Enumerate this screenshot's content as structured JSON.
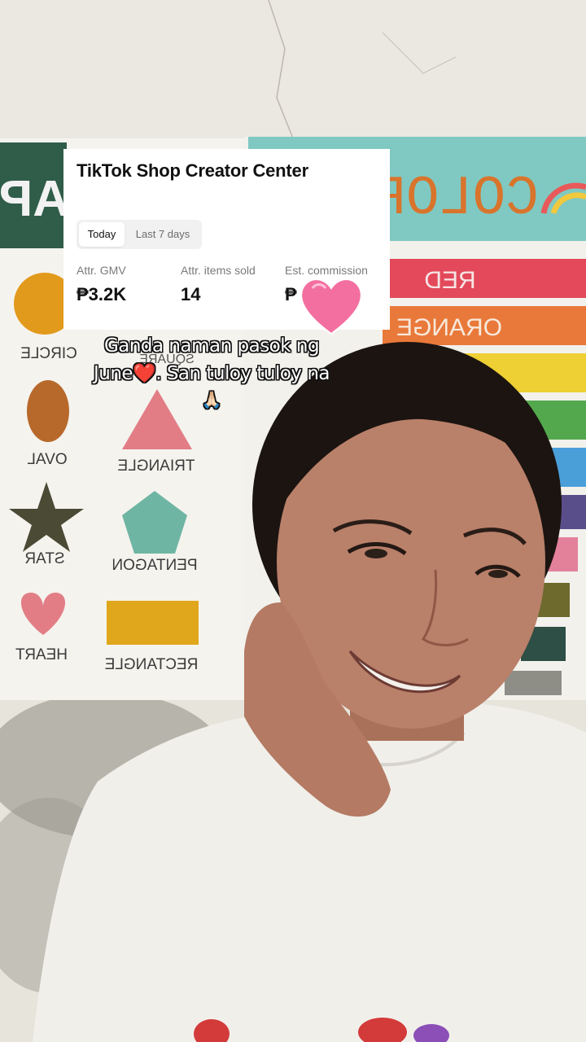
{
  "card": {
    "title": "TikTok Shop Creator Center",
    "tabs": [
      {
        "label": "Today",
        "selected": true
      },
      {
        "label": "Last 7 days",
        "selected": false
      }
    ],
    "metrics": [
      {
        "label": "Attr. GMV",
        "value": "₱3.2K"
      },
      {
        "label": "Attr. items sold",
        "value": "14"
      },
      {
        "label": "Est. commission",
        "value": "₱"
      }
    ]
  },
  "caption": {
    "line1": "Ganda naman pasok ng",
    "line2": "June❤️. San tuloy tuloy na",
    "line3": "🙏🏻"
  },
  "chart_signs": {
    "shapes_header": "APE",
    "colors_header": "COLOR",
    "shapes": [
      "CIRCLE",
      "SQUARE",
      "OVAL",
      "TRIANGLE",
      "STAR",
      "PENTAGON",
      "HEART",
      "RECTANGLE"
    ],
    "colors": [
      "RED",
      "ORANGE"
    ]
  },
  "colors": {
    "card_bg": "#ffffff",
    "heart_sticker": "#f36fa0",
    "wall": "#e9e6df",
    "teal_banner": "#7fc9c2",
    "green_banner": "#2f5d4a"
  }
}
